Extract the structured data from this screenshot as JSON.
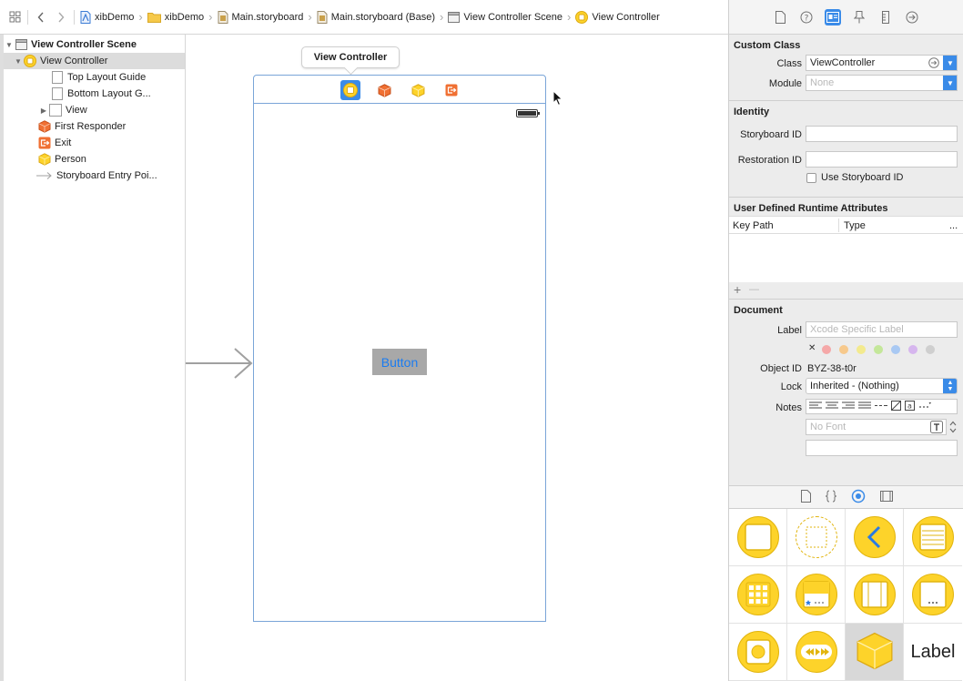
{
  "breadcrumbs": [
    {
      "label": "xibDemo",
      "icon": "project-file-icon"
    },
    {
      "label": "xibDemo",
      "icon": "folder-icon"
    },
    {
      "label": "Main.storyboard",
      "icon": "storyboard-file-icon"
    },
    {
      "label": "Main.storyboard (Base)",
      "icon": "storyboard-file-icon"
    },
    {
      "label": "View Controller Scene",
      "icon": "scene-icon"
    },
    {
      "label": "View Controller",
      "icon": "view-controller-icon"
    }
  ],
  "outline": {
    "scene": "View Controller Scene",
    "view_controller": "View Controller",
    "top_layout_guide": "Top Layout Guide",
    "bottom_layout_guide": "Bottom Layout G...",
    "view": "View",
    "first_responder": "First Responder",
    "exit": "Exit",
    "person": "Person",
    "entry_point": "Storyboard Entry Poi..."
  },
  "canvas": {
    "tooltip": "View Controller",
    "button_label": "Button"
  },
  "inspector": {
    "custom_class": {
      "title": "Custom Class",
      "class_label": "Class",
      "class_value": "ViewController",
      "module_label": "Module",
      "module_value": "None"
    },
    "identity": {
      "title": "Identity",
      "storyboard_id_label": "Storyboard ID",
      "storyboard_id_value": "",
      "restoration_id_label": "Restoration ID",
      "restoration_id_value": "",
      "use_storyboard_id_label": "Use Storyboard ID"
    },
    "runtime_attributes": {
      "title": "User Defined Runtime Attributes",
      "col_key_path": "Key Path",
      "col_type": "Type",
      "col_more": "...",
      "add": "+",
      "remove": "—"
    },
    "document": {
      "title": "Document",
      "label_label": "Label",
      "label_placeholder": "Xcode Specific Label",
      "clear": "✕",
      "object_id_label": "Object ID",
      "object_id_value": "BYZ-38-t0r",
      "lock_label": "Lock",
      "lock_value": "Inherited - (Nothing)",
      "notes_label": "Notes",
      "font_placeholder": "No Font"
    }
  },
  "library": {
    "label_item": "Label"
  },
  "colors": {
    "accent": "#3a8be8",
    "vc_yellow": "#fdd32a",
    "responder_orange": "#f07033",
    "ui_button_blue": "#1b7cf0"
  }
}
